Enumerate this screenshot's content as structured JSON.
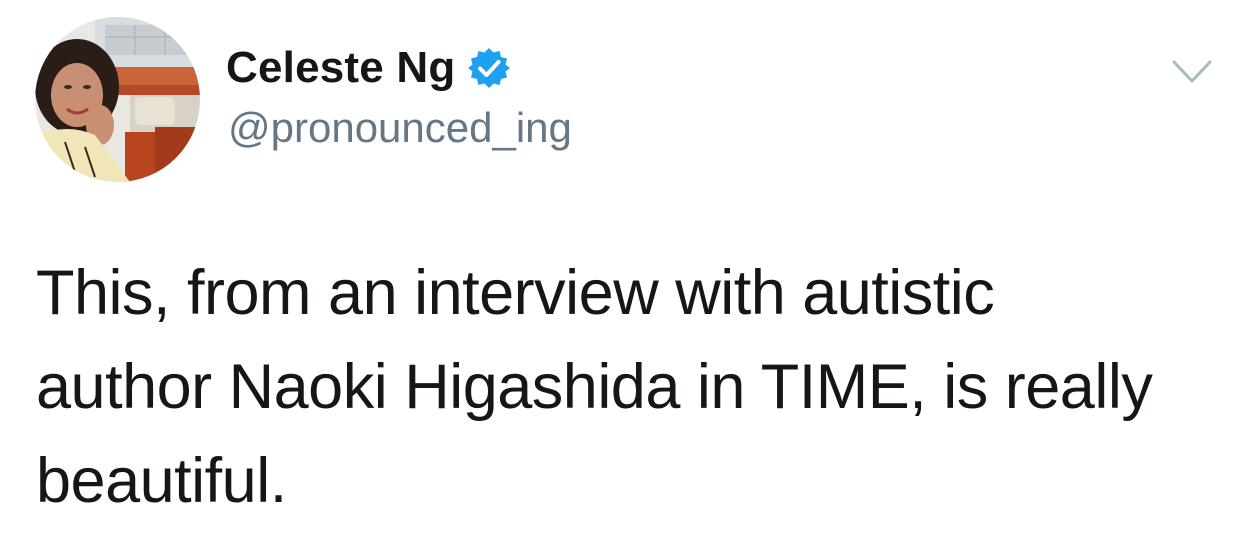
{
  "tweet": {
    "author": {
      "display_name": "Celeste Ng",
      "handle": "@pronounced_ing",
      "verified": true,
      "avatar_icon": "profile-photo"
    },
    "menu_icon": "chevron-down-icon",
    "text_lines": [
      "This, from an interview with autistic",
      "author Naoki Higashida in TIME, is really",
      "beautiful."
    ]
  },
  "colors": {
    "verified_blue": "#1da1f2",
    "text": "#14171a",
    "secondary_text": "#657786",
    "chevron": "#aab8c2"
  }
}
